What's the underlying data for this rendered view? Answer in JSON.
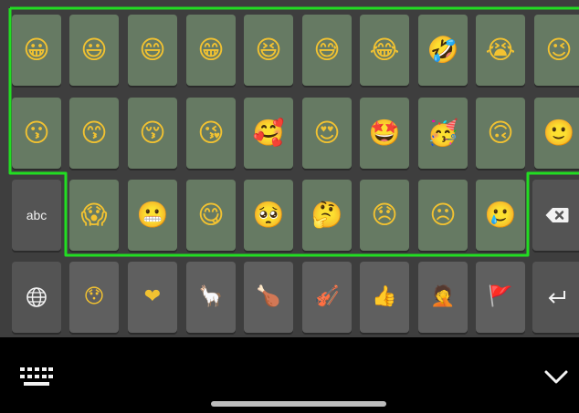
{
  "keyboard": {
    "row1": [
      {
        "name": "grinning-face-icon",
        "glyph": "😀"
      },
      {
        "name": "grinning-big-eyes-icon",
        "glyph": "😃"
      },
      {
        "name": "grinning-smiling-eyes-icon",
        "glyph": "😄"
      },
      {
        "name": "beaming-face-icon",
        "glyph": "😁"
      },
      {
        "name": "squinting-face-icon",
        "glyph": "😆"
      },
      {
        "name": "sweat-smile-icon",
        "glyph": "😅"
      },
      {
        "name": "tears-of-joy-icon",
        "glyph": "😂"
      },
      {
        "name": "rolling-laughing-icon",
        "glyph": "🤣"
      },
      {
        "name": "loudly-crying-icon",
        "glyph": "😭"
      },
      {
        "name": "winking-face-icon",
        "glyph": "😉"
      }
    ],
    "row2": [
      {
        "name": "kissing-face-icon",
        "glyph": "😗"
      },
      {
        "name": "kissing-smiling-eyes-icon",
        "glyph": "😙"
      },
      {
        "name": "kissing-closed-eyes-icon",
        "glyph": "😚"
      },
      {
        "name": "face-blowing-kiss-icon",
        "glyph": "😘"
      },
      {
        "name": "smiling-hearts-icon",
        "glyph": "🥰"
      },
      {
        "name": "heart-eyes-icon",
        "glyph": "😍"
      },
      {
        "name": "star-struck-icon",
        "glyph": "🤩"
      },
      {
        "name": "partying-face-icon",
        "glyph": "🥳"
      },
      {
        "name": "upside-down-face-icon",
        "glyph": "🙃"
      },
      {
        "name": "slightly-smiling-icon",
        "glyph": "🙂"
      }
    ],
    "row3": [
      {
        "name": "screaming-fear-icon",
        "glyph": "😱"
      },
      {
        "name": "grimacing-face-icon",
        "glyph": "😬"
      },
      {
        "name": "face-savoring-food-icon",
        "glyph": "😋"
      },
      {
        "name": "pleading-face-icon",
        "glyph": "🥺"
      },
      {
        "name": "thinking-face-icon",
        "glyph": "🤔"
      },
      {
        "name": "disappointed-face-icon",
        "glyph": "😞"
      },
      {
        "name": "frowning-face-icon",
        "glyph": "☹"
      },
      {
        "name": "holding-back-tears-icon",
        "glyph": "🥲"
      }
    ],
    "abc_label": "abc",
    "row4": [
      {
        "name": "hushed-face-icon",
        "glyph": "😯"
      },
      {
        "name": "red-heart-icon",
        "glyph": "❤"
      },
      {
        "name": "llama-icon",
        "glyph": "🦙"
      },
      {
        "name": "poultry-leg-icon",
        "glyph": "🍗"
      },
      {
        "name": "violin-icon",
        "glyph": "🎻"
      },
      {
        "name": "thumbs-up-icon",
        "glyph": "👍"
      },
      {
        "name": "person-facepalming-icon",
        "glyph": "🤦"
      },
      {
        "name": "triangular-flag-icon",
        "glyph": "🚩"
      }
    ]
  },
  "colors": {
    "highlight_outline": "#22dd22",
    "key_bg": "#5f5f5f",
    "highlight_key_bg": "#667a63"
  }
}
